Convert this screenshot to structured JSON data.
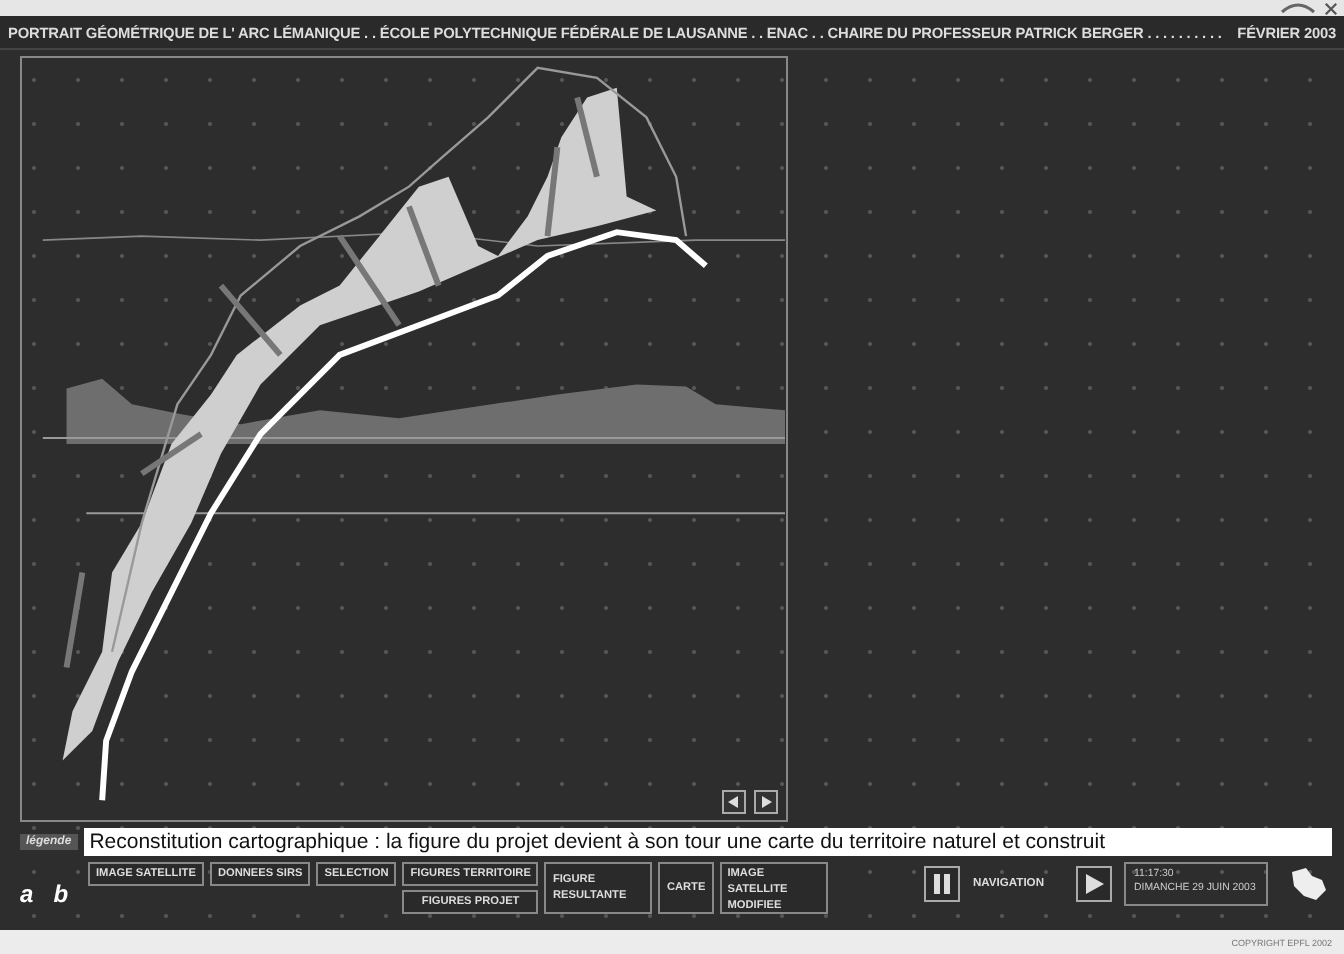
{
  "header": {
    "title": "PORTRAIT GÉOMÉTRIQUE DE L' ARC LÉMANIQUE . . ÉCOLE POLYTECHNIQUE FÉDÉRALE DE LAUSANNE . . ENAC . . CHAIRE DU PROFESSEUR PATRICK BERGER . . . . . . . . . .",
    "date": "FÉVRIER 2003"
  },
  "legend": {
    "label": "légende",
    "text": "Reconstitution cartographique : la figure du projet devient à son tour une carte du territoire naturel et construit"
  },
  "letters": [
    "a",
    "b"
  ],
  "buttons": [
    {
      "kind": "single",
      "label": "IMAGE SATELLITE"
    },
    {
      "kind": "single",
      "label": "DONNEES SIRS"
    },
    {
      "kind": "single",
      "label": "SELECTION"
    },
    {
      "kind": "stack",
      "labels": [
        "FIGURES TERRITOIRE",
        "FIGURES PROJET"
      ]
    },
    {
      "kind": "tall",
      "label": "FIGURE RESULTANTE"
    },
    {
      "kind": "tall",
      "label": "CARTE"
    },
    {
      "kind": "tall",
      "label": "IMAGE SATELLITE MODIFIEE"
    }
  ],
  "navigation": {
    "label": "NAVIGATION",
    "time": "11:17:30",
    "date": "DIMANCHE 29 JUIN 2003"
  },
  "footer": {
    "copyright": "COPYRIGHT EPFL 2002"
  }
}
